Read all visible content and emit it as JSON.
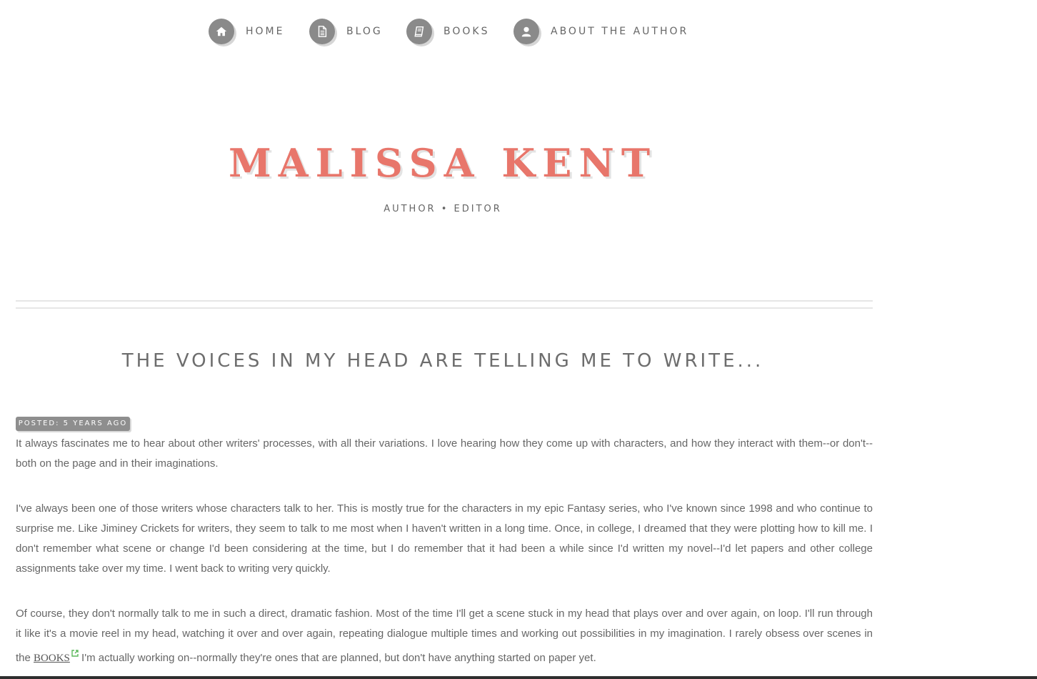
{
  "nav": {
    "items": [
      {
        "label": "HOME",
        "icon": "home-icon"
      },
      {
        "label": "BLOG",
        "icon": "document-icon"
      },
      {
        "label": "BOOKS",
        "icon": "book-icon"
      },
      {
        "label": "ABOUT THE AUTHOR",
        "icon": "user-icon"
      }
    ]
  },
  "header": {
    "title": "MALISSA KENT",
    "tagline": "AUTHOR • EDITOR"
  },
  "post": {
    "title": "THE VOICES IN MY HEAD ARE TELLING ME TO WRITE...",
    "posted": "POSTED: 5 YEARS AGO",
    "paragraphs": [
      "It always fascinates me to hear about other writers' processes, with all their variations. I love hearing how they come up with characters, and how they interact with them--or don't--both on the page and in their imaginations.",
      "I've always been one of those writers whose characters talk to her. This is mostly true for the characters in my epic Fantasy series, who I've known since 1998 and who continue to surprise me. Like Jiminey Crickets for writers, they seem to talk to me most when I haven't written in a long time. Once, in college, I dreamed that they were plotting how to kill me. I don't remember what scene or change I'd been considering at the time, but I do remember that it had been a while since I'd written my novel--I'd let papers and other college assignments take over my time. I went back to writing very quickly.",
      "Of course, they don't normally talk to me in such a direct, dramatic fashion. Most of the time I'll get a scene stuck in my head that plays over and over again, on loop. I'll run through it like it's a movie reel in my head, watching it over and over again, repeating dialogue multiple times and working out possibilities in my imagination. I rarely obsess over scenes in the"
    ],
    "paragraph_3_link": "BOOKS",
    "paragraph_3_tail": " I'm actually working on--normally they're ones that are planned, but don't have anything started on paper yet."
  },
  "colors": {
    "accent": "#e8766b",
    "nav_circle": "#8a8a8a",
    "text": "#666666",
    "link_icon": "#5cb85c"
  }
}
